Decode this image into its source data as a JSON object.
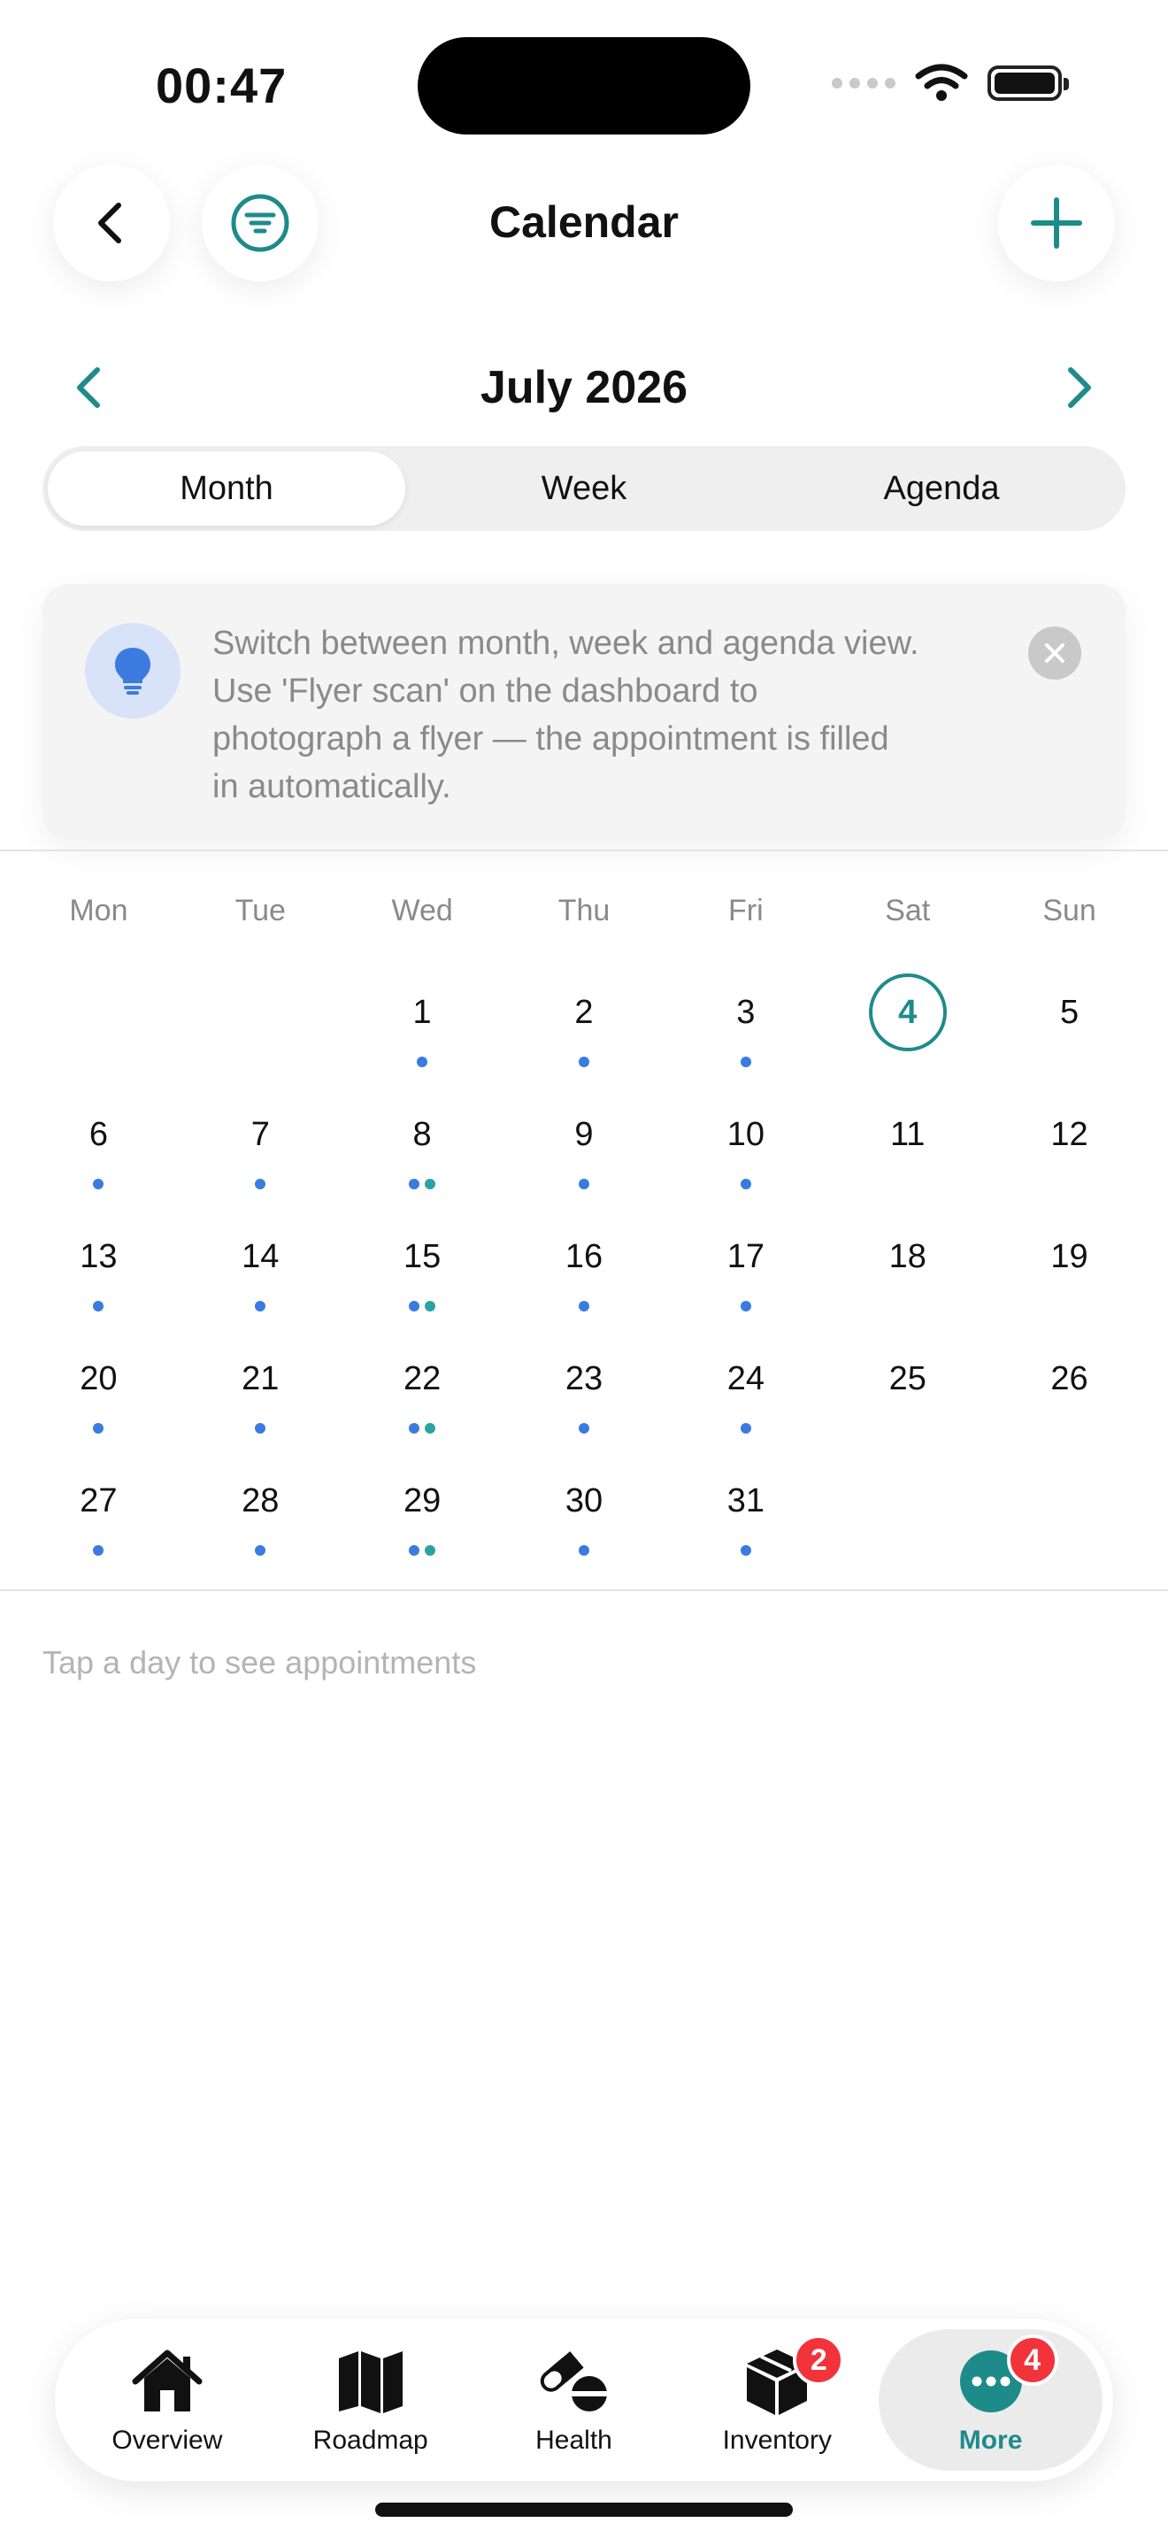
{
  "status": {
    "time": "00:47"
  },
  "header": {
    "title": "Calendar"
  },
  "month_nav": {
    "label": "July 2026"
  },
  "view_tabs": [
    {
      "label": "Month",
      "active": true
    },
    {
      "label": "Week",
      "active": false
    },
    {
      "label": "Agenda",
      "active": false
    }
  ],
  "tip": {
    "text": "Switch between month, week and agenda view. Use 'Flyer scan' on the dashboard to photograph a flyer — the appointment is filled in automatically."
  },
  "calendar": {
    "weekdays": [
      "Mon",
      "Tue",
      "Wed",
      "Thu",
      "Fri",
      "Sat",
      "Sun"
    ],
    "leading_blank_days": 2,
    "today": 4,
    "days": [
      {
        "n": "1",
        "dots": [
          "blue"
        ]
      },
      {
        "n": "2",
        "dots": [
          "blue"
        ]
      },
      {
        "n": "3",
        "dots": [
          "blue"
        ]
      },
      {
        "n": "4",
        "dots": []
      },
      {
        "n": "5",
        "dots": []
      },
      {
        "n": "6",
        "dots": [
          "blue"
        ]
      },
      {
        "n": "7",
        "dots": [
          "blue"
        ]
      },
      {
        "n": "8",
        "dots": [
          "blue",
          "teal"
        ]
      },
      {
        "n": "9",
        "dots": [
          "blue"
        ]
      },
      {
        "n": "10",
        "dots": [
          "blue"
        ]
      },
      {
        "n": "11",
        "dots": []
      },
      {
        "n": "12",
        "dots": []
      },
      {
        "n": "13",
        "dots": [
          "blue"
        ]
      },
      {
        "n": "14",
        "dots": [
          "blue"
        ]
      },
      {
        "n": "15",
        "dots": [
          "blue",
          "teal"
        ]
      },
      {
        "n": "16",
        "dots": [
          "blue"
        ]
      },
      {
        "n": "17",
        "dots": [
          "blue"
        ]
      },
      {
        "n": "18",
        "dots": []
      },
      {
        "n": "19",
        "dots": []
      },
      {
        "n": "20",
        "dots": [
          "blue"
        ]
      },
      {
        "n": "21",
        "dots": [
          "blue"
        ]
      },
      {
        "n": "22",
        "dots": [
          "blue",
          "teal"
        ]
      },
      {
        "n": "23",
        "dots": [
          "blue"
        ]
      },
      {
        "n": "24",
        "dots": [
          "blue"
        ]
      },
      {
        "n": "25",
        "dots": []
      },
      {
        "n": "26",
        "dots": []
      },
      {
        "n": "27",
        "dots": [
          "blue"
        ]
      },
      {
        "n": "28",
        "dots": [
          "blue"
        ]
      },
      {
        "n": "29",
        "dots": [
          "blue",
          "teal"
        ]
      },
      {
        "n": "30",
        "dots": [
          "blue"
        ]
      },
      {
        "n": "31",
        "dots": [
          "blue"
        ]
      }
    ]
  },
  "empty_hint": "Tap a day to see appointments",
  "tabbar": [
    {
      "label": "Overview",
      "icon": "house-icon",
      "badge": null,
      "active": false
    },
    {
      "label": "Roadmap",
      "icon": "map-icon",
      "badge": null,
      "active": false
    },
    {
      "label": "Health",
      "icon": "pills-icon",
      "badge": null,
      "active": false
    },
    {
      "label": "Inventory",
      "icon": "box-icon",
      "badge": "2",
      "active": false
    },
    {
      "label": "More",
      "icon": "more-dots-icon",
      "badge": "4",
      "active": true
    }
  ],
  "colors": {
    "accent": "#1e8b8b",
    "dot_blue": "#3b7be0",
    "dot_teal": "#2aa3a3",
    "badge": "#f2333a",
    "tip_icon_bg": "#d8e2f8",
    "tip_icon": "#3b7be0"
  }
}
